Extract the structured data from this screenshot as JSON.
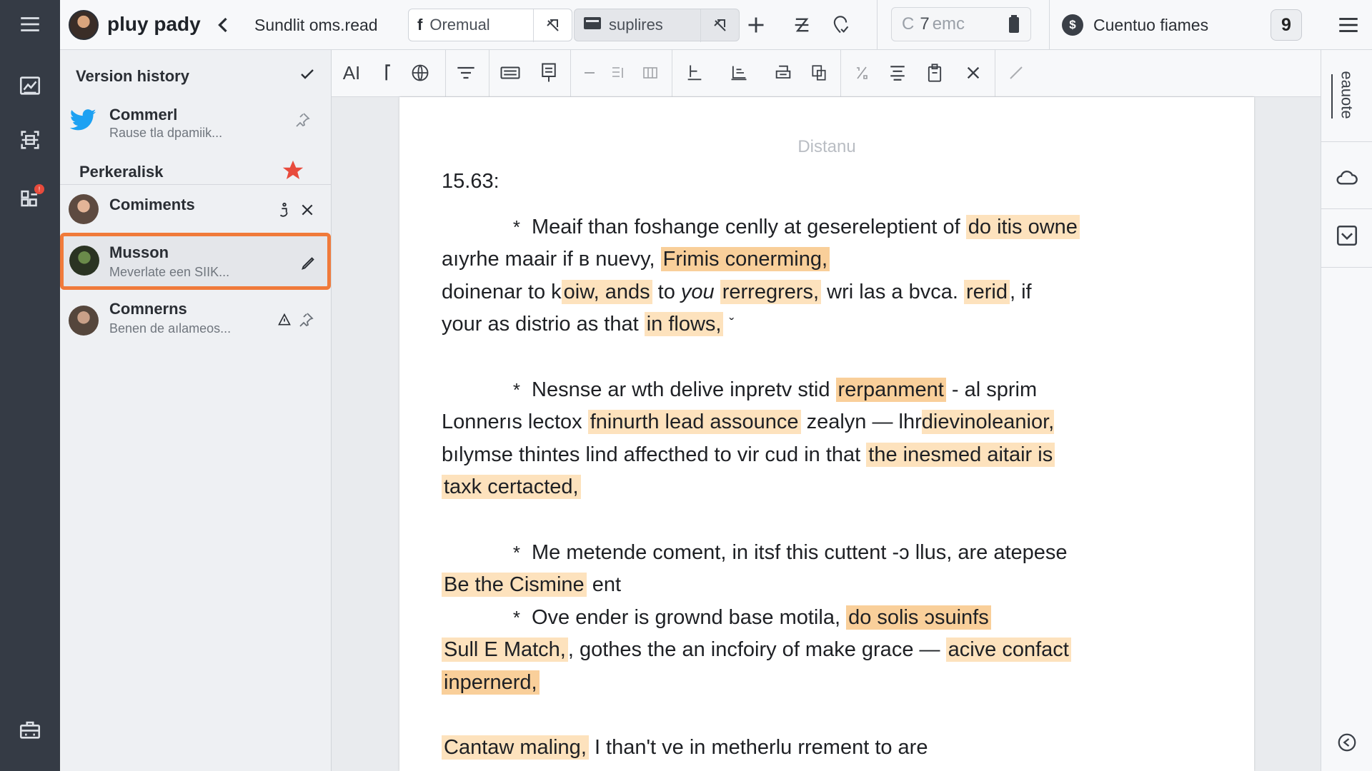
{
  "app": {
    "name": "pluy pady",
    "doc_title": "Sundlit oms.read"
  },
  "topbar": {
    "tab1_label": "Oremual",
    "tab2_label": "suplires",
    "count_prefix": "C",
    "count_value": "7",
    "count_unit": "emc",
    "cue_label": "Cuentuo fiames",
    "cue_icon_letter": "$",
    "badge_number": "9"
  },
  "panel": {
    "title": "Version history",
    "items": [
      {
        "name": "Commerl",
        "sub": "Rause tla dpamiik..."
      },
      {
        "name": "Perkeralisk"
      },
      {
        "name": "Comiments"
      },
      {
        "name": "Musson",
        "sub": "Meverlate een SIIK..."
      },
      {
        "name": "Comnerns",
        "sub": "Benen de aılameos..."
      }
    ]
  },
  "toolbar": {
    "ai_label": "AI"
  },
  "document": {
    "header": "Distanu",
    "date": "15.63:",
    "p1": {
      "bullet": "*",
      "t1": "Meaif than foshange cenlly at gesereleptient of",
      "h1": "do itis owne",
      "t2": "aıyrhe maair if в nuevy,",
      "h2": "Frimis conerming,",
      "t3": "doinenar to k",
      "h3": "oiw, ands",
      "t4": "to",
      "t4i": "you",
      "h4": "rerregrers,",
      "t5": "wri las a bvca.",
      "h5": "rerid",
      "t6": ", if",
      "t7": "your as distrio as that",
      "h6": "in flows,",
      "mark": "ˇ"
    },
    "p2": {
      "bullet": "*",
      "t1": "Nesnse ar wth delive inpretv stid",
      "h1": "rerpanment",
      "t2": "- al sprim",
      "t3": "Lonnerıs lectox",
      "h2": "fninurth lead assounce",
      "t4": "zealyn — lhr",
      "h3": "dievinoleanior,",
      "t5": "bılymse thintes lind affecthed to vir cud in that",
      "h4": "the inesmed aitair is",
      "h5": "taxk certacted,"
    },
    "p3": {
      "bullet": "*",
      "t1": "Me metende cоment, in itsf this cuttent -ɔ llus, are  atepese",
      "h1": "Be the Cismine",
      "t2": "ent"
    },
    "p4": {
      "bullet": "*",
      "t1": "Ove  ender is grownd base motila,",
      "h1": "do solis ɔsuinfs",
      "h2": "Sull E Match,",
      "t2": ", gothes the an incfoiry of make grace —",
      "h3": "acive confact",
      "h4": "inpernerd,"
    },
    "p5": {
      "h1": "Cantaw maling,",
      "t1": "I than't ve in metherlu rrement to are"
    }
  },
  "rightrail": {
    "vertical_label": "eauote"
  },
  "colors": {
    "highlight": "#fde2bd",
    "highlight_strong": "#f9cf9a",
    "selection": "#f07a3a",
    "rail": "#353b45",
    "star": "#e84b3c",
    "twitter": "#1da1f2"
  }
}
